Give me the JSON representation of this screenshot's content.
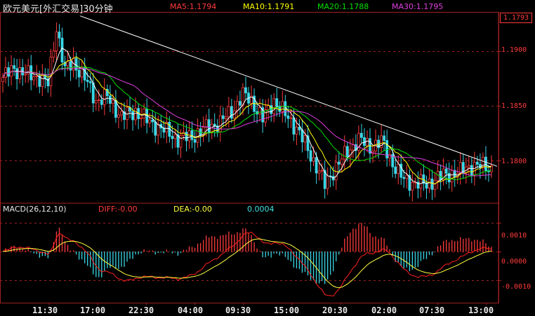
{
  "header": {
    "title": "欧元美元[外汇交易]30分钟",
    "ma5": "MA5:1.1794",
    "ma10": "MA10:1.1791",
    "ma20": "MA20:1.1788",
    "ma30": "MA30:1.1795"
  },
  "macd_header": {
    "label": "MACD(26,12,10)",
    "diff": "DIFF:-0.00",
    "dea": "DEA:-0.00",
    "hist": "0.0004"
  },
  "current_price": "1.1793",
  "colors": {
    "up": "#ff3b3b",
    "down": "#38d6e6",
    "ma5": "#ffffff",
    "ma10": "#ffff00",
    "ma20": "#00e000",
    "ma30": "#e040e0",
    "diff": "#ff2020",
    "dea": "#ffff40",
    "grid": "#a02020"
  },
  "chart_data": [
    {
      "type": "candlestick",
      "title": "欧元美元[外汇交易]30分钟",
      "ylim": [
        1.1762,
        1.1935
      ],
      "y_ticks": [
        "1.1900",
        "1.1850",
        "1.1800"
      ],
      "x_ticks": [
        "11:30",
        "17:00",
        "22:30",
        "04:00",
        "09:30",
        "15:00",
        "20:30",
        "02:00",
        "07:30",
        "13:00"
      ],
      "series": [
        {
          "name": "MA5:1.1794"
        },
        {
          "name": "MA10:1.1791"
        },
        {
          "name": "MA20:1.1788"
        },
        {
          "name": "MA30:1.1795"
        }
      ],
      "trendline": {
        "from_label": "17:00",
        "from_value": 1.1932,
        "to_label": "13:00",
        "to_value": 1.1795
      },
      "close_anchors": [
        [
          0,
          1.1876
        ],
        [
          4,
          1.1884
        ],
        [
          9,
          1.1878
        ],
        [
          13,
          1.1876
        ],
        [
          16,
          1.187
        ],
        [
          19,
          1.1922
        ],
        [
          22,
          1.1882
        ],
        [
          25,
          1.189
        ],
        [
          29,
          1.1875
        ],
        [
          33,
          1.1855
        ],
        [
          37,
          1.1858
        ],
        [
          42,
          1.184
        ],
        [
          47,
          1.1845
        ],
        [
          52,
          1.1835
        ],
        [
          57,
          1.1828
        ],
        [
          62,
          1.182
        ],
        [
          67,
          1.1822
        ],
        [
          72,
          1.183
        ],
        [
          77,
          1.1835
        ],
        [
          82,
          1.1848
        ],
        [
          85,
          1.186
        ],
        [
          88,
          1.1855
        ],
        [
          92,
          1.1838
        ],
        [
          96,
          1.1855
        ],
        [
          100,
          1.1842
        ],
        [
          104,
          1.183
        ],
        [
          108,
          1.181
        ],
        [
          112,
          1.179
        ],
        [
          114,
          1.1778
        ],
        [
          118,
          1.1795
        ],
        [
          122,
          1.1808
        ],
        [
          126,
          1.182
        ],
        [
          130,
          1.1812
        ],
        [
          134,
          1.1818
        ],
        [
          138,
          1.1798
        ],
        [
          142,
          1.1782
        ],
        [
          146,
          1.178
        ],
        [
          150,
          1.1778
        ],
        [
          154,
          1.1785
        ],
        [
          158,
          1.1788
        ],
        [
          162,
          1.179
        ],
        [
          166,
          1.1796
        ],
        [
          170,
          1.1795
        ],
        [
          173,
          1.1793
        ]
      ]
    },
    {
      "type": "bar",
      "title": "MACD(26,12,10)",
      "ylim": [
        -0.0018,
        0.0017
      ],
      "y_ticks": [
        "0.0010",
        "0.0000",
        "-0.0010"
      ],
      "series": [
        {
          "name": "DIFF:-0.00"
        },
        {
          "name": "DEA:-0.00"
        }
      ]
    }
  ]
}
